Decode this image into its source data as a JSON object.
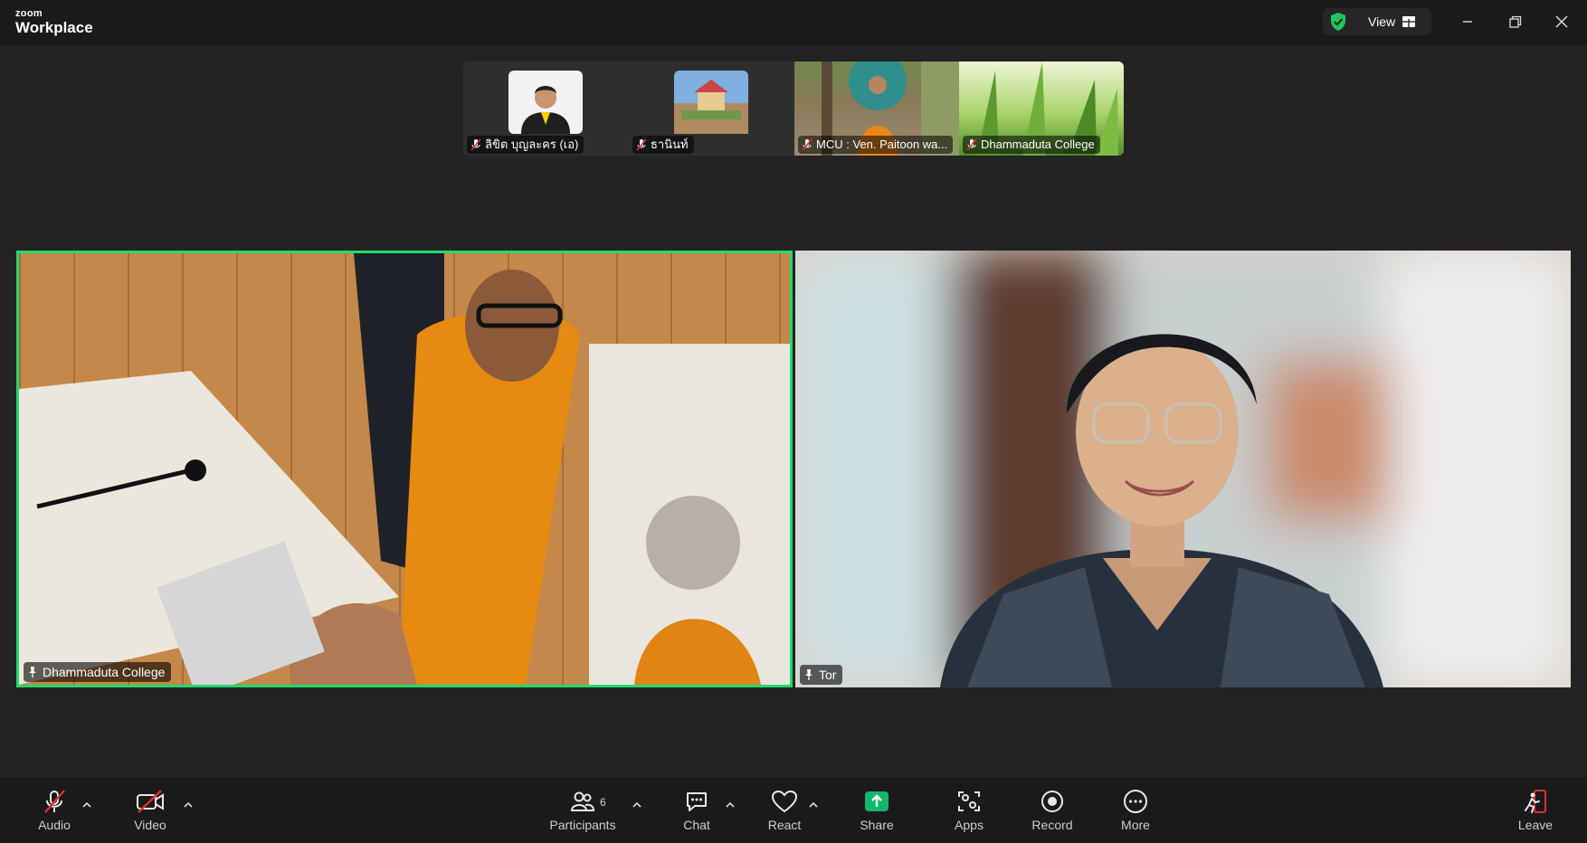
{
  "app": {
    "brand_small": "zoom",
    "brand_big": "Workplace"
  },
  "titlebar": {
    "view_label": "View"
  },
  "thumbnails": [
    {
      "name": "ลิขิต บุญละคร (เอ)",
      "muted": true
    },
    {
      "name": "ธานินท์",
      "muted": true
    },
    {
      "name": "MCU : Ven. Paitoon wa...",
      "muted": true
    },
    {
      "name": "Dhammaduta College",
      "muted": true
    }
  ],
  "main_tiles": [
    {
      "name": "Dhammaduta College",
      "pinned": true,
      "active_speaker": true
    },
    {
      "name": "Tor",
      "pinned": true,
      "active_speaker": false
    }
  ],
  "toolbar": {
    "audio": "Audio",
    "video": "Video",
    "participants": "Participants",
    "participants_count": "6",
    "chat": "Chat",
    "react": "React",
    "share": "Share",
    "apps": "Apps",
    "record": "Record",
    "more": "More",
    "leave": "Leave"
  },
  "colors": {
    "active_speaker_border": "#23d96b",
    "share_green": "#12b76a",
    "muted_red": "#e02e2e",
    "shield_green": "#22c55e"
  }
}
